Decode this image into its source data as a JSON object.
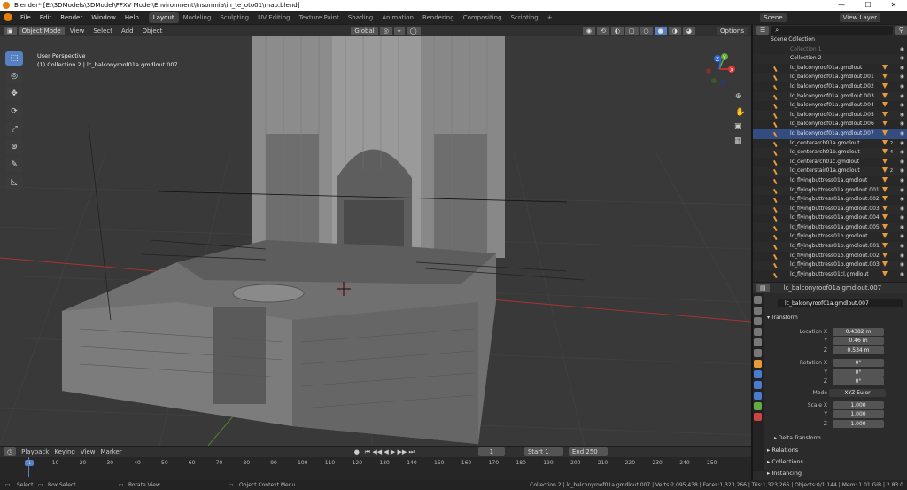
{
  "window": {
    "title": "Blender* [E:\\3DModels\\3DModel\\FFXV Model\\Environment\\Insomnia\\in_te_oto01\\map.blend]",
    "minimize": "—",
    "maximize": "☐",
    "close": "✕"
  },
  "menu": [
    "File",
    "Edit",
    "Render",
    "Window",
    "Help"
  ],
  "workspaces": [
    "Layout",
    "Modeling",
    "Sculpting",
    "UV Editing",
    "Texture Paint",
    "Shading",
    "Animation",
    "Rendering",
    "Compositing",
    "Scripting"
  ],
  "active_workspace": "Layout",
  "add_workspace": "+",
  "scene": {
    "label": "Scene",
    "view_layer": "View Layer"
  },
  "viewport_header": {
    "mode": "Object Mode",
    "view": "View",
    "select": "Select",
    "add": "Add",
    "object": "Object",
    "orientation": "Global",
    "options": "Options"
  },
  "viewport": {
    "perspective": "User Perspective",
    "collection_line": "(1) Collection 2 | lc_balconyroof01a.gmdlout.007",
    "gizmo": {
      "x": "X",
      "y": "Y",
      "z": "Z"
    }
  },
  "outliner": {
    "root": "Scene Collection",
    "collection1": "Collection 1",
    "collection2": "Collection 2",
    "items": [
      {
        "name": "lc_balconyroof01a.gmdlout",
        "sub": ""
      },
      {
        "name": "lc_balconyroof01a.gmdlout.001",
        "sub": ""
      },
      {
        "name": "lc_balconyroof01a.gmdlout.002",
        "sub": ""
      },
      {
        "name": "lc_balconyroof01a.gmdlout.003",
        "sub": ""
      },
      {
        "name": "lc_balconyroof01a.gmdlout.004",
        "sub": ""
      },
      {
        "name": "lc_balconyroof01a.gmdlout.005",
        "sub": ""
      },
      {
        "name": "lc_balconyroof01a.gmdlout.006",
        "sub": ""
      },
      {
        "name": "lc_balconyroof01a.gmdlout.007",
        "sub": ""
      },
      {
        "name": "lc_centerarch01a.gmdlout",
        "sub": "2"
      },
      {
        "name": "lc_centerarch01b.gmdlout",
        "sub": "4"
      },
      {
        "name": "lc_centerarch01c.gmdlout",
        "sub": ""
      },
      {
        "name": "lc_centerstair01a.gmdlout",
        "sub": "2"
      },
      {
        "name": "lc_flyingbuttress01a.gmdlout",
        "sub": ""
      },
      {
        "name": "lc_flyingbuttress01a.gmdlout.001",
        "sub": ""
      },
      {
        "name": "lc_flyingbuttress01a.gmdlout.002",
        "sub": ""
      },
      {
        "name": "lc_flyingbuttress01a.gmdlout.003",
        "sub": ""
      },
      {
        "name": "lc_flyingbuttress01a.gmdlout.004",
        "sub": ""
      },
      {
        "name": "lc_flyingbuttress01a.gmdlout.005",
        "sub": ""
      },
      {
        "name": "lc_flyingbuttress01b.gmdlout",
        "sub": ""
      },
      {
        "name": "lc_flyingbuttress01b.gmdlout.001",
        "sub": ""
      },
      {
        "name": "lc_flyingbuttress01b.gmdlout.002",
        "sub": ""
      },
      {
        "name": "lc_flyingbuttress01b.gmdlout.003",
        "sub": ""
      },
      {
        "name": "lc_flyingbuttress01cl.gmdlout",
        "sub": ""
      }
    ]
  },
  "properties": {
    "object_name": "lc_balconyroof01a.gmdlout.007",
    "object_field": "lc_balconyroof01a.gmdlout.007",
    "transform": "Transform",
    "location_x_label": "Location X",
    "y_label": "Y",
    "z_label": "Z",
    "location": [
      "0.4382 m",
      "0.46 m",
      "0.534 m"
    ],
    "rotation_x_label": "Rotation X",
    "rotation": [
      "0°",
      "0°",
      "0°"
    ],
    "mode_label": "Mode",
    "mode": "XYZ Euler",
    "scale_x_label": "Scale X",
    "scale": [
      "1.000",
      "1.000",
      "1.000"
    ],
    "delta_transform": "Delta Transform",
    "sections": [
      "Relations",
      "Collections",
      "Instancing"
    ]
  },
  "timeline": {
    "playback": "Playback",
    "keying": "Keying",
    "view": "View",
    "marker": "Marker",
    "current_frame": "1",
    "start_label": "Start",
    "start": "1",
    "end_label": "End",
    "end": "250",
    "ticks": [
      "1",
      "10",
      "20",
      "30",
      "40",
      "50",
      "60",
      "70",
      "80",
      "90",
      "100",
      "110",
      "120",
      "130",
      "140",
      "150",
      "160",
      "170",
      "180",
      "190",
      "200",
      "210",
      "220",
      "230",
      "240",
      "250"
    ]
  },
  "status": {
    "select": "Select",
    "box_select": "Box Select",
    "rotate_view": "Rotate View",
    "context_menu": "Object Context Menu",
    "info": "Collection 2 | lc_balconyroof01a.gmdlout.007 | Verts:2,095,438 | Faces:1,323,266 | Tris:1,323,266 | Objects:0/1,144 | Mem: 1.01 GiB | 2.83.0"
  }
}
